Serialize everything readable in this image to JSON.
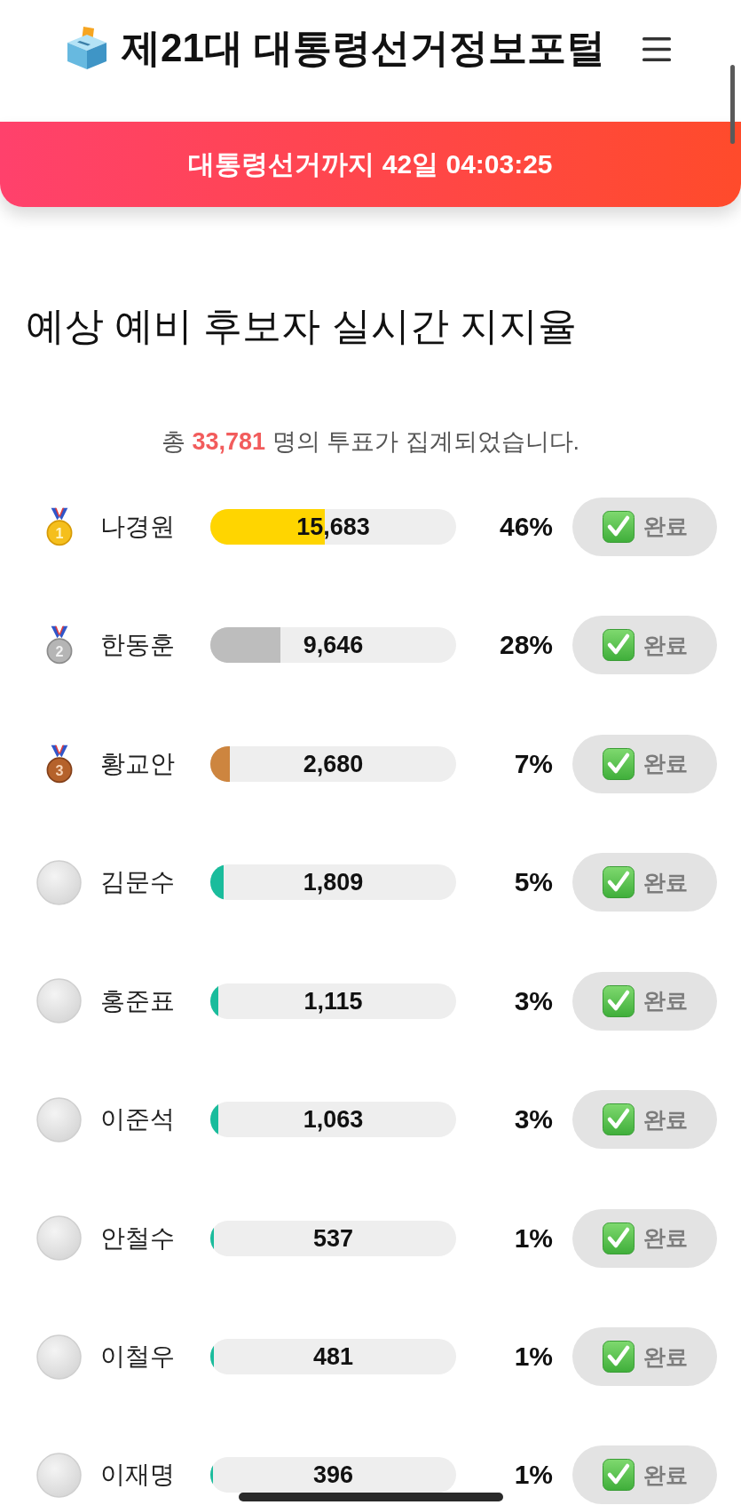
{
  "header": {
    "title": "제21대 대통령선거정보포털"
  },
  "countdown": {
    "text": "대통령선거까지 42일 04:03:25"
  },
  "poll": {
    "heading": "예상 예비 후보자 실시간 지지율",
    "summary": "총 **33,781** 명의 투표가 집계되었습니다."
  },
  "candidates": [
    {
      "kind": "gold",
      "rank": "1",
      "name": "나경원",
      "votes": "15,683",
      "level": 0.464,
      "color": "#ffd500",
      "percent": "46%",
      "button": {
        "label": "완료",
        "disabled": true
      }
    },
    {
      "kind": "silver",
      "rank": "2",
      "name": "한동훈",
      "votes": "9,646",
      "level": 0.286,
      "color": "#bdbdbd",
      "percent": "28%",
      "button": {
        "label": "완료",
        "disabled": true
      }
    },
    {
      "kind": "bronze",
      "rank": "3",
      "name": "황교안",
      "votes": "2,680",
      "level": 0.079,
      "color": "#cd853f",
      "percent": "7%",
      "button": {
        "label": "완료",
        "disabled": true
      }
    },
    {
      "kind": "plain",
      "name": "김문수",
      "votes": "1,809",
      "level": 0.054,
      "color": "#1abc9c",
      "percent": "5%",
      "button": {
        "label": "완료",
        "disabled": true
      }
    },
    {
      "kind": "plain",
      "name": "홍준표",
      "votes": "1,115",
      "level": 0.033,
      "color": "#1abc9c",
      "percent": "3%",
      "button": {
        "label": "완료",
        "disabled": true
      }
    },
    {
      "kind": "plain",
      "name": "이준석",
      "votes": "1,063",
      "level": 0.031,
      "color": "#1abc9c",
      "percent": "3%",
      "button": {
        "label": "완료",
        "disabled": true
      }
    },
    {
      "kind": "plain",
      "name": "안철수",
      "votes": "537",
      "level": 0.016,
      "color": "#1abc9c",
      "percent": "1%",
      "button": {
        "label": "완료",
        "disabled": true
      }
    },
    {
      "kind": "plain",
      "name": "이철우",
      "votes": "481",
      "level": 0.014,
      "color": "#1abc9c",
      "percent": "1%",
      "button": {
        "label": "완료",
        "disabled": true
      }
    },
    {
      "kind": "plain",
      "name": "이재명",
      "votes": "396",
      "level": 0.012,
      "color": "#1abc9c",
      "percent": "1%",
      "button": {
        "label": "완료",
        "disabled": true
      }
    }
  ]
}
